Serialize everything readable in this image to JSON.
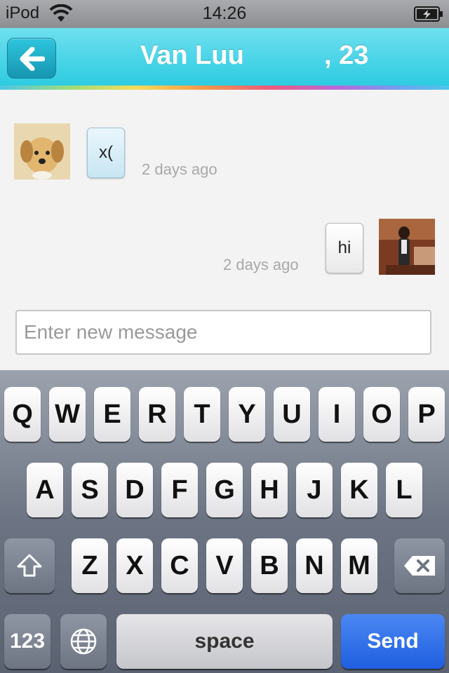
{
  "status_bar": {
    "carrier": "iPod",
    "time": "14:26"
  },
  "nav": {
    "back_icon": "arrow-left-icon",
    "title_name": "Van Luu",
    "title_age": ", 23"
  },
  "messages": [
    {
      "direction": "incoming",
      "text": "x(",
      "time": "2 days ago",
      "avatar": "puppy-photo"
    },
    {
      "direction": "outgoing",
      "text": "hi",
      "time": "2 days ago",
      "avatar": "user-photo"
    }
  ],
  "composer": {
    "placeholder": "Enter new message",
    "value": ""
  },
  "keyboard": {
    "row1": [
      "Q",
      "W",
      "E",
      "R",
      "T",
      "Y",
      "U",
      "I",
      "O",
      "P"
    ],
    "row2": [
      "A",
      "S",
      "D",
      "F",
      "G",
      "H",
      "J",
      "K",
      "L"
    ],
    "row3": [
      "Z",
      "X",
      "C",
      "V",
      "B",
      "N",
      "M"
    ],
    "numbers_label": "123",
    "space_label": "space",
    "send_label": "Send"
  }
}
